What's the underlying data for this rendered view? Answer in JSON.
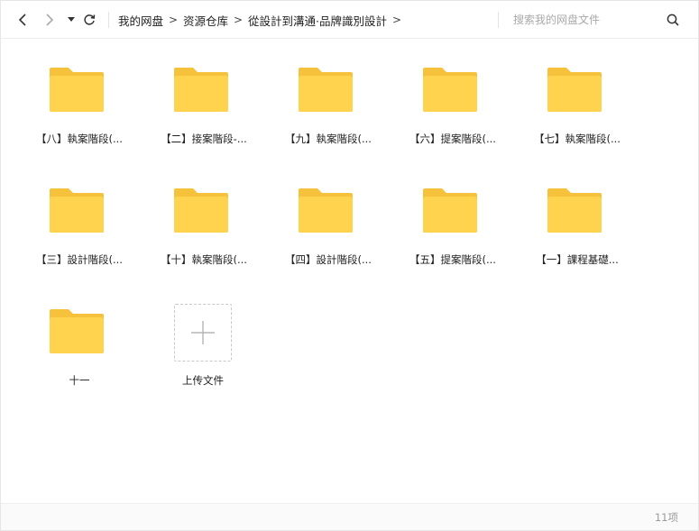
{
  "toolbar": {
    "icons": [
      "back-icon",
      "forward-icon",
      "dropdown-icon",
      "refresh-icon"
    ],
    "breadcrumb": [
      "我的网盘",
      "资源仓库",
      "從設計到溝通·品牌識別設計"
    ],
    "breadcrumb_separator": ">",
    "search_placeholder": "搜索我的网盘文件",
    "search_icon": "search-icon"
  },
  "items": [
    {
      "name": "【八】執案階段(...",
      "type": "folder"
    },
    {
      "name": "【二】接案階段-...",
      "type": "folder"
    },
    {
      "name": "【九】執案階段(...",
      "type": "folder"
    },
    {
      "name": "【六】提案階段(...",
      "type": "folder"
    },
    {
      "name": "【七】執案階段(...",
      "type": "folder"
    },
    {
      "name": "【三】設計階段(...",
      "type": "folder"
    },
    {
      "name": "【十】執案階段(...",
      "type": "folder"
    },
    {
      "name": "【四】設計階段(...",
      "type": "folder"
    },
    {
      "name": "【五】提案階段(...",
      "type": "folder"
    },
    {
      "name": "【一】課程基礎...",
      "type": "folder"
    },
    {
      "name": "十一",
      "type": "folder"
    }
  ],
  "upload": {
    "label": "上传文件",
    "icon": "plus-icon"
  },
  "footer": {
    "count": "11项"
  },
  "colors": {
    "folder": "#FFD34E",
    "folder_tab": "#F7C23B",
    "text": "#222222",
    "muted": "#999999"
  }
}
